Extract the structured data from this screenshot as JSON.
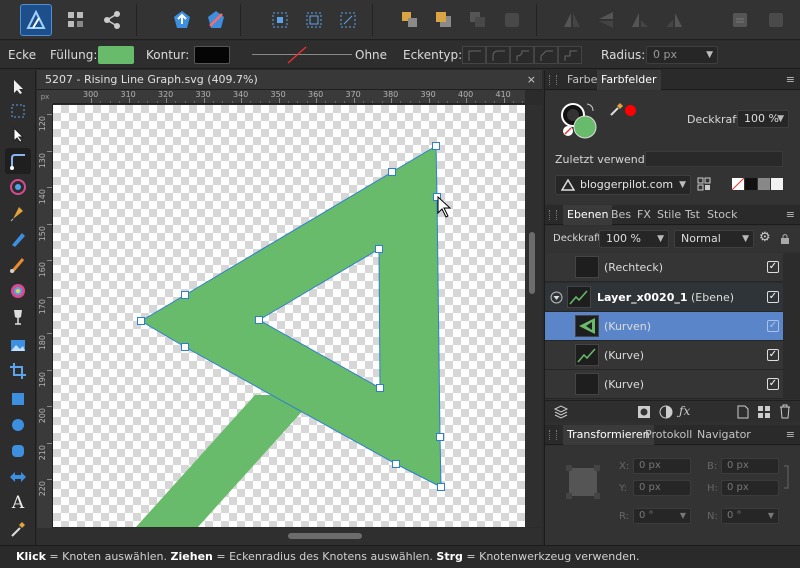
{
  "app": {
    "logo": "affinity-designer-logo"
  },
  "colors": {
    "fill": "#67bb6a",
    "accent": "#5a86c9",
    "node_stroke": "#2d7fd1"
  },
  "toolbar": {
    "icons": [
      "designer-persona-icon",
      "pixel-persona-icon",
      "export-persona-icon",
      "snapping-icon",
      "no-snapping-icon",
      "align-icon",
      "transform-icon",
      "geometry-icon",
      "arrange-front-icon",
      "arrange-forward-icon",
      "arrange-back-icon",
      "arrange-behind-icon",
      "flip-horizontal-icon",
      "flip-vertical-icon",
      "rotate-icon"
    ]
  },
  "context": {
    "tool_name": "Ecke",
    "fill_label": "Füllung:",
    "stroke_label": "Kontur:",
    "stroke_none_label": "Ohne",
    "corner_type_label": "Eckentyp:",
    "radius_label": "Radius:",
    "radius_value": "0 px"
  },
  "document": {
    "tab_title": "5207 - Rising Line Graph.svg (409.7%)",
    "close": "×",
    "ruler_unit": "px",
    "top_ticks": [
      "300",
      "310",
      "320",
      "330",
      "340",
      "350",
      "360",
      "370",
      "380",
      "390",
      "400",
      "410"
    ],
    "left_ticks": [
      "120",
      "130",
      "140",
      "150",
      "160",
      "170",
      "180",
      "190",
      "200",
      "210",
      "220"
    ]
  },
  "color_panel": {
    "tab_color": "Farbe",
    "tab_swatches": "Farbfelder",
    "opacity_label": "Deckkraft:",
    "opacity_value": "100 %",
    "recent_label": "Zuletzt verwendet:",
    "palette_name": "bloggerpilot.com"
  },
  "layers_panel": {
    "tabs": [
      "Ebenen",
      "Bes",
      "FX",
      "Stile",
      "Tst",
      "Stock"
    ],
    "opacity_label": "Deckkraft:",
    "opacity_value": "100 %",
    "blend_mode": "Normal",
    "rows": [
      {
        "label": "(Rechteck)",
        "bold": "",
        "suffix": "",
        "checked": "✓"
      },
      {
        "label": "",
        "bold": "Layer_x0020_1",
        "suffix": " (Ebene)",
        "checked": "✓"
      },
      {
        "label": "(Kurven)",
        "bold": "",
        "suffix": "",
        "checked": "✓"
      },
      {
        "label": "(Kurve)",
        "bold": "",
        "suffix": "",
        "checked": "✓"
      },
      {
        "label": "(Kurve)",
        "bold": "",
        "suffix": "",
        "checked": "✓"
      }
    ]
  },
  "transform_panel": {
    "tabs": [
      "Transformieren",
      "Protokoll",
      "Navigator"
    ],
    "x_label": "X:",
    "x_value": "0 px",
    "y_label": "Y:",
    "y_value": "0 px",
    "w_label": "B:",
    "w_value": "0 px",
    "h_label": "H:",
    "h_value": "0 px",
    "r_label": "R:",
    "r_value": "0 °",
    "s_label": "N:",
    "s_value": "0 °"
  },
  "status": {
    "click_key": "Klick",
    "click_text": " = Knoten auswählen. ",
    "drag_key": "Ziehen",
    "drag_text": " = Eckenradius des Knotens auswählen. ",
    "ctrl_key": "Strg",
    "ctrl_text": " = Knotenwerkzeug verwenden."
  }
}
